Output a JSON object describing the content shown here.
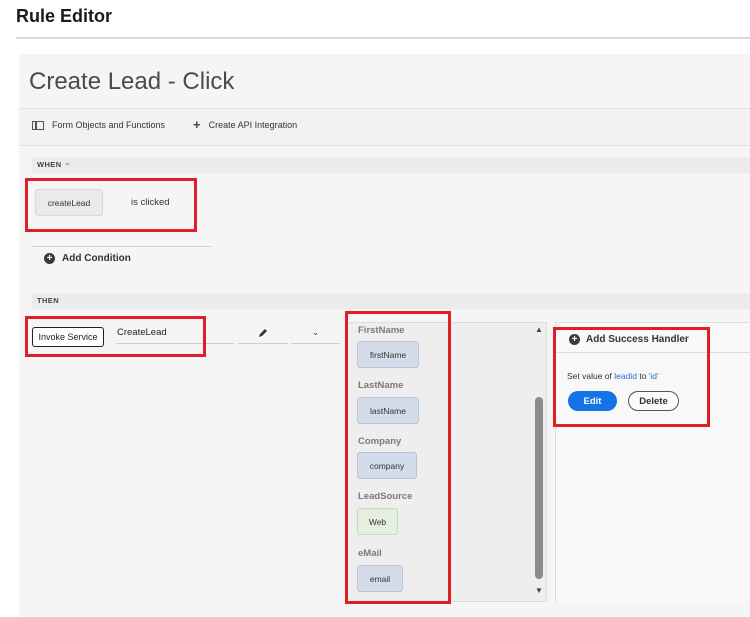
{
  "app": {
    "title": "Rule Editor"
  },
  "rule": {
    "name": "Create Lead - Click"
  },
  "toolbar": {
    "objects_label": "Form Objects and Functions",
    "objects_icon": "panel-icon",
    "api_label": "Create API Integration",
    "api_icon": "plus-icon"
  },
  "when": {
    "label": "WHEN",
    "component": "createLead",
    "event": "is clicked",
    "add_condition": "Add Condition"
  },
  "then": {
    "label": "THEN",
    "action": "Invoke Service",
    "service": "CreateLead",
    "params": [
      {
        "label": "FirstName",
        "value": "firstName",
        "kind": "field"
      },
      {
        "label": "LastName",
        "value": "lastName",
        "kind": "field"
      },
      {
        "label": "Company",
        "value": "company",
        "kind": "field"
      },
      {
        "label": "LeadSource",
        "value": "Web",
        "kind": "literal"
      },
      {
        "label": "eMail",
        "value": "email",
        "kind": "field"
      }
    ]
  },
  "success_handler": {
    "add_label": "Add Success Handler",
    "summary_prefix": "Set value of",
    "summary_field": "leadid",
    "summary_mid": "to",
    "summary_value": "'id'",
    "edit_label": "Edit",
    "delete_label": "Delete"
  },
  "colors": {
    "highlight": "#e11d25",
    "accent": "#1473e6",
    "link": "#2d6bd0"
  }
}
